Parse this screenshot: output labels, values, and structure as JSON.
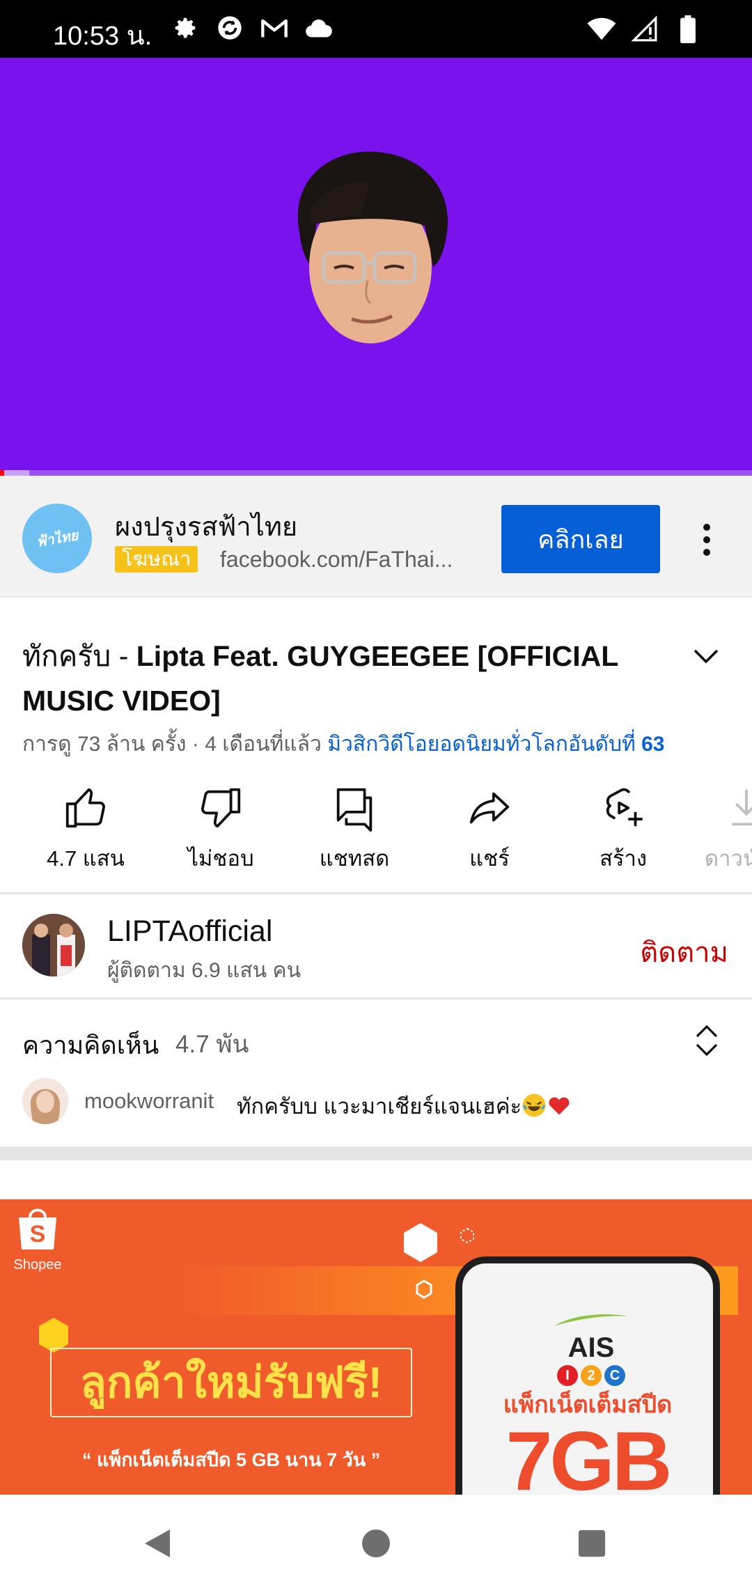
{
  "status_bar": {
    "time": "10:53 น.",
    "left_icons": [
      "gear-icon",
      "sync-icon",
      "gmail-icon",
      "cloud-icon"
    ],
    "right_icons": [
      "wifi-icon",
      "signal-icon",
      "battery-icon"
    ]
  },
  "video": {
    "background_color": "#7a12ee",
    "progress": 0.035
  },
  "ad": {
    "advertiser": "ผงปรุงรสฟ้าไทย",
    "badge": "โฆษณา",
    "url": "facebook.com/FaThai...",
    "cta_label": "คลิกเลย",
    "avatar_text": "ฟ้าไทย"
  },
  "video_info": {
    "title_prefix": "ทักครับ - ",
    "title_main": "Lipta Feat. GUYGEEGEE [OFFICIAL MUSIC VIDEO]",
    "views": "การดู 73 ล้าน ครั้ง",
    "separator": " · ",
    "age": "4 เดือนที่แล้ว",
    "trending_prefix": "มิวสิกวิดีโอยอดนิยมทั่วโลกอันดับที่ ",
    "trending_rank": "63"
  },
  "actions": [
    {
      "label": "4.7 แสน",
      "icon": "thumbs-up-icon"
    },
    {
      "label": "ไม่ชอบ",
      "icon": "thumbs-down-icon"
    },
    {
      "label": "แชทสด",
      "icon": "live-chat-icon"
    },
    {
      "label": "แชร์",
      "icon": "share-icon"
    },
    {
      "label": "สร้าง",
      "icon": "create-icon"
    },
    {
      "label": "ดาวน์",
      "icon": "download-icon"
    }
  ],
  "channel": {
    "name": "LIPTAofficial",
    "subscribers": "ผู้ติดตาม 6.9 แสน คน",
    "subscribe_label": "ติดตาม"
  },
  "comments": {
    "label": "ความคิดเห็น",
    "count": "4.7 พัน",
    "top_comment": {
      "author": "mookworranit",
      "text": "ทักครับบ แวะมาเชียร์แจนเฮค่ะ"
    }
  },
  "promo": {
    "brand": "Shopee",
    "headline": "ลูกค้าใหม่รับฟรี!",
    "subline": "“ แพ็กเน็ตเต็มสปีด 5 GB นาน 7 วัน ”",
    "carrier": "AIS",
    "carrier_badge": [
      "I",
      "2",
      "C"
    ],
    "phone_line1": "แพ็กเน็ตเต็มสปีด",
    "phone_line2": "7GB"
  },
  "nav": [
    "back-icon",
    "home-icon",
    "recents-icon"
  ]
}
